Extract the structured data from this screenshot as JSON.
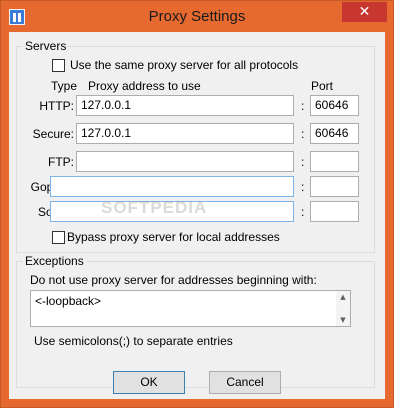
{
  "window": {
    "title": "Proxy Settings",
    "close_glyph": "✕"
  },
  "servers": {
    "group_label": "Servers",
    "same_proxy_label": "Use the same proxy server for all protocols",
    "same_proxy_checked": false,
    "col_type": "Type",
    "col_address": "Proxy address to use",
    "col_port": "Port",
    "colon": ":",
    "rows": [
      {
        "label": "HTTP:",
        "address": "127.0.0.1",
        "port": "60646"
      },
      {
        "label": "Secure:",
        "address": "127.0.0.1",
        "port": "60646"
      },
      {
        "label": "FTP:",
        "address": "",
        "port": ""
      },
      {
        "label": "Gopher:",
        "address": "",
        "port": ""
      },
      {
        "label": "Socks:",
        "address": "",
        "port": ""
      }
    ],
    "bypass_label": "Bypass proxy server for local addresses",
    "bypass_checked": false
  },
  "exceptions": {
    "group_label": "Exceptions",
    "description": "Do not use proxy server for addresses beginning with:",
    "value": "<-loopback>",
    "hint": "Use semicolons(;) to separate entries"
  },
  "buttons": {
    "ok": "OK",
    "cancel": "Cancel"
  },
  "watermark": "SOFTPEDIA"
}
